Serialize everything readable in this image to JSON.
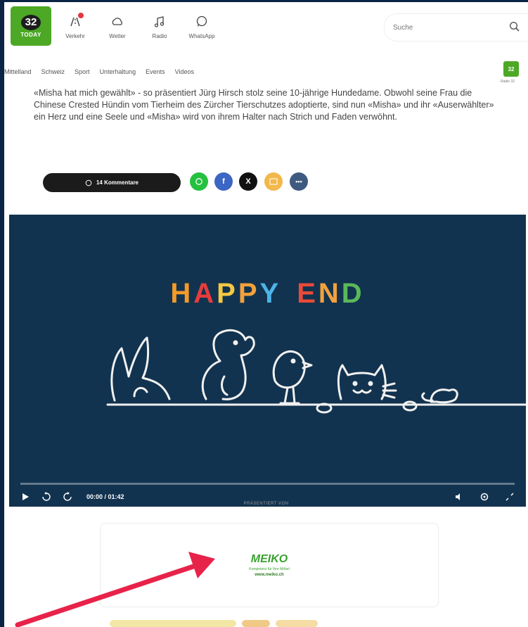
{
  "header": {
    "logo_number": "32",
    "logo_text": "TODAY",
    "nav": [
      {
        "label": "Verkehr",
        "icon": "traffic-icon"
      },
      {
        "label": "Wetter",
        "icon": "weather-icon"
      },
      {
        "label": "Radio",
        "icon": "music-icon"
      },
      {
        "label": "WhatsApp",
        "icon": "whatsapp-icon"
      }
    ],
    "search_placeholder": "Suche"
  },
  "categories": [
    "Mittelland",
    "Schweiz",
    "Sport",
    "Unterhaltung",
    "Events",
    "Videos"
  ],
  "mini_logo": {
    "number": "32",
    "label": "Radio 32"
  },
  "article": {
    "lead": "«Misha hat mich gewählt» - so präsentiert Jürg Hirsch stolz seine 10-jährige Hundedame. Obwohl seine Frau die Chinese Crested Hündin vom Tierheim des Zürcher Tierschutzes adoptierte, sind nun «Misha» und ihr «Auserwählter» ein Herz und eine Seele und «Misha» wird von ihrem Halter nach Strich und Faden verwöhnt.",
    "comments_label": "14 Kommentare"
  },
  "share_buttons": [
    {
      "name": "whatsapp",
      "color": "#25c03f"
    },
    {
      "name": "facebook",
      "color": "#3b66c4"
    },
    {
      "name": "x",
      "color": "#111111"
    },
    {
      "name": "email",
      "color": "#f2b84b"
    },
    {
      "name": "more",
      "color": "#3f5a80"
    }
  ],
  "video": {
    "title_letters": [
      {
        "char": "H",
        "color": "#f39a2a"
      },
      {
        "char": "A",
        "color": "#e63d3d"
      },
      {
        "char": "P",
        "color": "#f5c842"
      },
      {
        "char": "P",
        "color": "#f3a13c"
      },
      {
        "char": "Y",
        "color": "#4cb4e8"
      },
      {
        "char": " ",
        "color": "#ffffff"
      },
      {
        "char": "E",
        "color": "#e94a3a"
      },
      {
        "char": "N",
        "color": "#f3a13c"
      },
      {
        "char": "D",
        "color": "#5ab85a"
      }
    ],
    "time": "00:00 / 01:42",
    "background": "#12334f"
  },
  "sponsor": {
    "presented_by": "PRÄSENTIERT VON",
    "brand": "MEIKO",
    "tagline": "Kompetenz für Ihre Möbel",
    "url": "www.meiko.ch"
  },
  "annotation": {
    "color": "#e8234a"
  }
}
